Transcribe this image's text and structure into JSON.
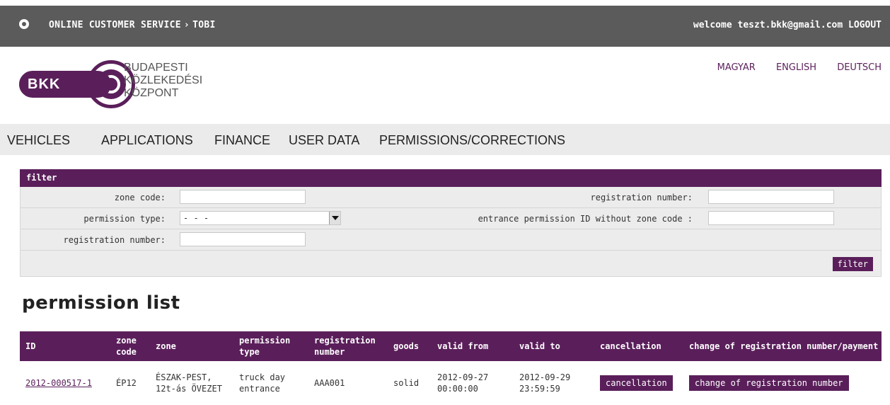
{
  "topbar": {
    "breadcrumb_root": "ONLINE CUSTOMER SERVICE",
    "breadcrumb_sep": "›",
    "breadcrumb_current": "TOBI",
    "welcome_prefix": "welcome teszt.bkk@gmail.com",
    "logout": "LOGOUT"
  },
  "logo": {
    "text": "BKK",
    "org_line1": "BUDAPESTI",
    "org_line2": "KÖZLEKEDÉSI",
    "org_line3": "KÖZPONT"
  },
  "languages": [
    "MAGYAR",
    "ENGLISH",
    "DEUTSCH"
  ],
  "nav": [
    "VEHICLES",
    "APPLICATIONS",
    "FINANCE",
    "USER DATA",
    "PERMISSIONS/CORRECTIONS"
  ],
  "filter": {
    "title": "filter",
    "zone_code_label": "zone code:",
    "zone_code_value": "",
    "reg_number_label_right": "registration number:",
    "reg_number_value_right": "",
    "permission_type_label": "permission type:",
    "permission_type_value": "- - -",
    "entrance_id_label": "entrance permission ID without zone code :",
    "entrance_id_value": "",
    "reg_number_label_left": "registration number:",
    "reg_number_value_left": "",
    "button": "filter"
  },
  "list": {
    "title": "permission list",
    "columns": [
      "ID",
      "zone code",
      "zone",
      "permission type",
      "registration number",
      "goods",
      "valid from",
      "valid to",
      "cancellation",
      "change of registration number/payment"
    ],
    "rows": [
      {
        "id": "2012-000517-1",
        "zone_code": "ÉP12",
        "zone": "ÉSZAK-PEST, 12t-ás ÖVEZET",
        "permission_type": "truck day entrance",
        "registration_number": "AAA001",
        "goods": "solid",
        "valid_from": "2012-09-27 00:00:00",
        "valid_to": "2012-09-29 23:59:59",
        "cancel_button": "cancellation",
        "change_button": "change of registration number"
      }
    ]
  },
  "colors": {
    "brand": "#5a1f5a",
    "topbar": "#5b5b5b",
    "nav_bg": "#ebebeb"
  }
}
